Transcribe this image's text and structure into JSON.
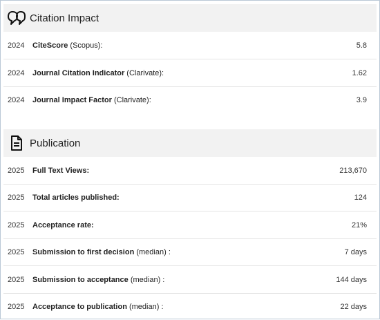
{
  "citation": {
    "title": "Citation Impact",
    "icon": "quote-bubble-icon",
    "rows": [
      {
        "year": "2024",
        "label": "CiteScore",
        "source": " (Scopus):",
        "value": "5.8"
      },
      {
        "year": "2024",
        "label": "Journal Citation Indicator",
        "source": " (Clarivate):",
        "value": "1.62"
      },
      {
        "year": "2024",
        "label": "Journal Impact Factor",
        "source": " (Clarivate):",
        "value": "3.9"
      }
    ]
  },
  "publication": {
    "title": "Publication",
    "icon": "document-icon",
    "rows": [
      {
        "year": "2025",
        "label": "Full Text Views:",
        "source": "",
        "value": "213,670"
      },
      {
        "year": "2025",
        "label": "Total articles published:",
        "source": "",
        "value": "124"
      },
      {
        "year": "2025",
        "label": "Acceptance rate:",
        "source": "",
        "value": "21%"
      },
      {
        "year": "2025",
        "label": "Submission to first decision",
        "source": " (median) :",
        "value": "7 days"
      },
      {
        "year": "2025",
        "label": "Submission to acceptance",
        "source": " (median) :",
        "value": "144 days"
      },
      {
        "year": "2025",
        "label": "Acceptance to publication",
        "source": " (median) :",
        "value": "22 days"
      }
    ]
  }
}
